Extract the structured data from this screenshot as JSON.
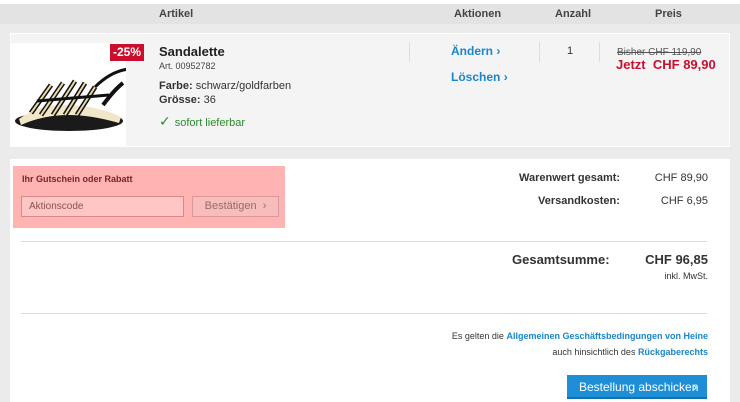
{
  "table_header": {
    "article": "Artikel",
    "actions": "Aktionen",
    "quantity": "Anzahl",
    "price": "Preis"
  },
  "item": {
    "discount_badge": "-25%",
    "name": "Sandalette",
    "article_no": "Art. 00952782",
    "color_label": "Farbe:",
    "color_value": "schwarz/goldfarben",
    "size_label": "Grösse:",
    "size_value": "36",
    "availability": "sofort lieferbar",
    "edit_link": "Ändern",
    "delete_link": "Löschen",
    "quantity": "1",
    "old_price": "Bisher CHF 119,90",
    "new_price_prefix": "Jetzt",
    "new_price": "CHF 89,90"
  },
  "coupon": {
    "title": "Ihr Gutschein oder Rabatt",
    "placeholder": "Aktionscode",
    "button": "Bestätigen"
  },
  "summary": {
    "goods_label": "Warenwert gesamt:",
    "goods_value": "CHF 89,90",
    "shipping_label": "Versandkosten:",
    "shipping_value": "CHF 6,95",
    "total_label": "Gesamtsumme:",
    "total_value": "CHF 96,85",
    "vat_note": "inkl. MwSt."
  },
  "terms": {
    "line1_prefix": "Es gelten die",
    "line1_link": "Allgemeinen Geschäftsbedingungen von Heine",
    "line2_prefix": "auch hinsichtlich des",
    "line2_link": "Rückgaberechts"
  },
  "order_button": "Bestellung abschicken",
  "colors": {
    "accent_blue": "#1e8fd6",
    "sale_red": "#c8102e",
    "available_green": "#2d8a2d",
    "coupon_highlight": "#ffb3b3"
  },
  "icons": {
    "chevron": "chevron-right-icon",
    "check": "check-icon"
  }
}
